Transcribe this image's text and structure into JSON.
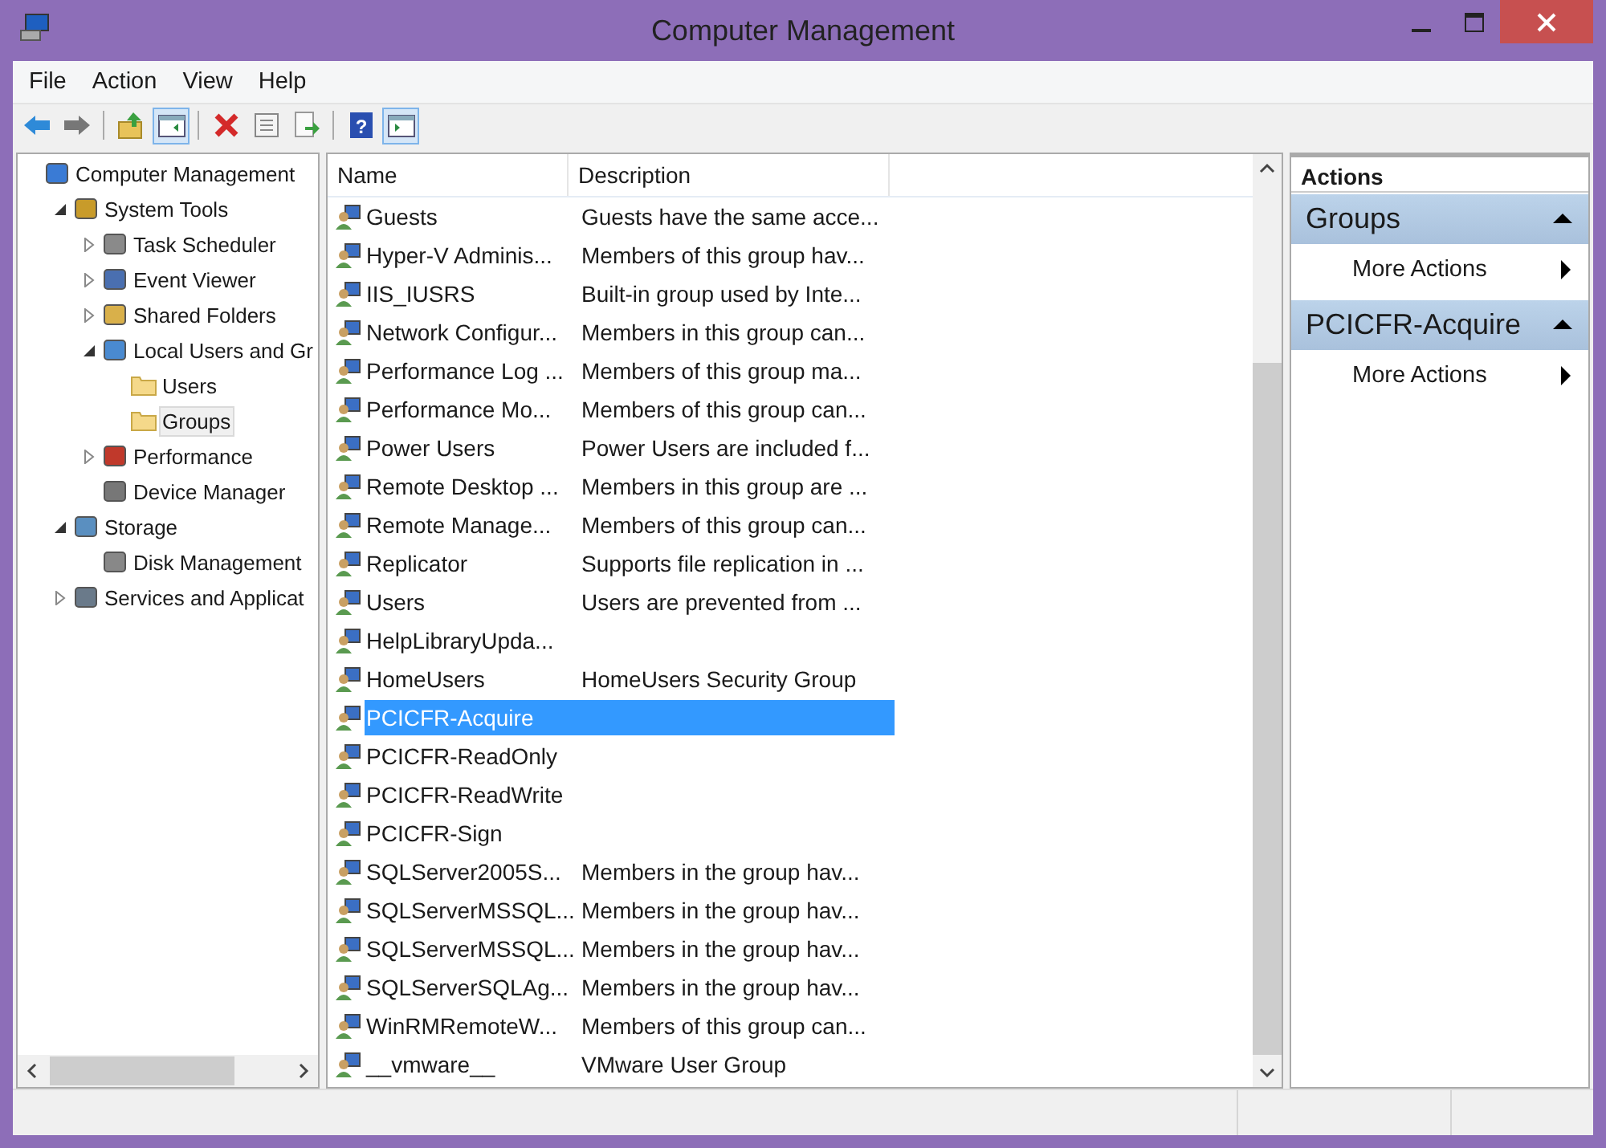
{
  "window": {
    "title": "Computer Management"
  },
  "menu": [
    "File",
    "Action",
    "View",
    "Help"
  ],
  "toolbar": [
    {
      "buttons": [
        {
          "kind": "back",
          "pressed": false
        },
        {
          "kind": "forward",
          "pressed": false
        }
      ]
    },
    {
      "buttons": [
        {
          "kind": "up",
          "pressed": false
        },
        {
          "kind": "tree",
          "pressed": true
        }
      ]
    },
    {
      "buttons": [
        {
          "kind": "delete",
          "pressed": false
        },
        {
          "kind": "properties",
          "pressed": false
        },
        {
          "kind": "export",
          "pressed": false
        }
      ]
    },
    {
      "buttons": [
        {
          "kind": "help",
          "pressed": false,
          "glyph": "?"
        },
        {
          "kind": "actionpane",
          "pressed": true
        }
      ]
    }
  ],
  "tree": [
    {
      "label": "Computer Management",
      "kind": "computer",
      "selected": false,
      "children": [
        {
          "label": "System Tools",
          "kind": "tools",
          "expanded": true,
          "selected": false,
          "children": [
            {
              "label": "Task Scheduler",
              "kind": "clock",
              "expanded": false,
              "selected": false
            },
            {
              "label": "Event Viewer",
              "kind": "log",
              "expanded": false,
              "selected": false
            },
            {
              "label": "Shared Folders",
              "kind": "share",
              "expanded": false,
              "selected": false
            },
            {
              "label": "Local Users and Gr",
              "kind": "users",
              "expanded": true,
              "selected": false,
              "children": [
                {
                  "label": "Users",
                  "kind": "folder",
                  "selected": false
                },
                {
                  "label": "Groups",
                  "kind": "folder",
                  "selected": true
                }
              ]
            },
            {
              "label": "Performance",
              "kind": "gauge",
              "expanded": false,
              "selected": false
            },
            {
              "label": "Device Manager",
              "kind": "device",
              "selected": false
            }
          ]
        },
        {
          "label": "Storage",
          "kind": "storage",
          "expanded": true,
          "selected": false,
          "children": [
            {
              "label": "Disk Management",
              "kind": "disk",
              "selected": false
            }
          ]
        },
        {
          "label": "Services and Applicat",
          "kind": "services",
          "expanded": false,
          "selected": false
        }
      ]
    }
  ],
  "table": {
    "columns": [
      "Name",
      "Description"
    ],
    "rows": [
      {
        "name": "Guests",
        "description": "Guests have the same acce...",
        "selected": false
      },
      {
        "name": "Hyper-V Adminis...",
        "description": "Members of this group hav...",
        "selected": false
      },
      {
        "name": "IIS_IUSRS",
        "description": "Built-in group used by Inte...",
        "selected": false
      },
      {
        "name": "Network Configur...",
        "description": "Members in this group can...",
        "selected": false
      },
      {
        "name": "Performance Log ...",
        "description": "Members of this group ma...",
        "selected": false
      },
      {
        "name": "Performance Mo...",
        "description": "Members of this group can...",
        "selected": false
      },
      {
        "name": "Power Users",
        "description": "Power Users are included f...",
        "selected": false
      },
      {
        "name": "Remote Desktop ...",
        "description": "Members in this group are ...",
        "selected": false
      },
      {
        "name": "Remote Manage...",
        "description": "Members of this group can...",
        "selected": false
      },
      {
        "name": "Replicator",
        "description": "Supports file replication in ...",
        "selected": false
      },
      {
        "name": "Users",
        "description": "Users are prevented from ...",
        "selected": false
      },
      {
        "name": "HelpLibraryUpda...",
        "selected": false
      },
      {
        "name": "HomeUsers",
        "description": "HomeUsers Security Group",
        "selected": false
      },
      {
        "name": "PCICFR-Acquire",
        "selected": true
      },
      {
        "name": "PCICFR-ReadOnly",
        "selected": false
      },
      {
        "name": "PCICFR-ReadWrite",
        "selected": false
      },
      {
        "name": "PCICFR-Sign",
        "selected": false
      },
      {
        "name": "SQLServer2005S...",
        "description": "Members in the group hav...",
        "selected": false
      },
      {
        "name": "SQLServerMSSQL...",
        "description": "Members in the group hav...",
        "selected": false
      },
      {
        "name": "SQLServerMSSQL...",
        "description": "Members in the group hav...",
        "selected": false
      },
      {
        "name": "SQLServerSQLAg...",
        "description": "Members in the group hav...",
        "selected": false
      },
      {
        "name": "WinRMRemoteW...",
        "description": "Members of this group can...",
        "selected": false
      },
      {
        "name": "__vmware__",
        "description": "VMware User Group",
        "selected": false
      }
    ]
  },
  "actions": {
    "title": "Actions",
    "sections": [
      {
        "title": "Groups",
        "items": [
          "More Actions"
        ]
      },
      {
        "title": "PCICFR-Acquire",
        "items": [
          "More Actions"
        ]
      }
    ]
  }
}
